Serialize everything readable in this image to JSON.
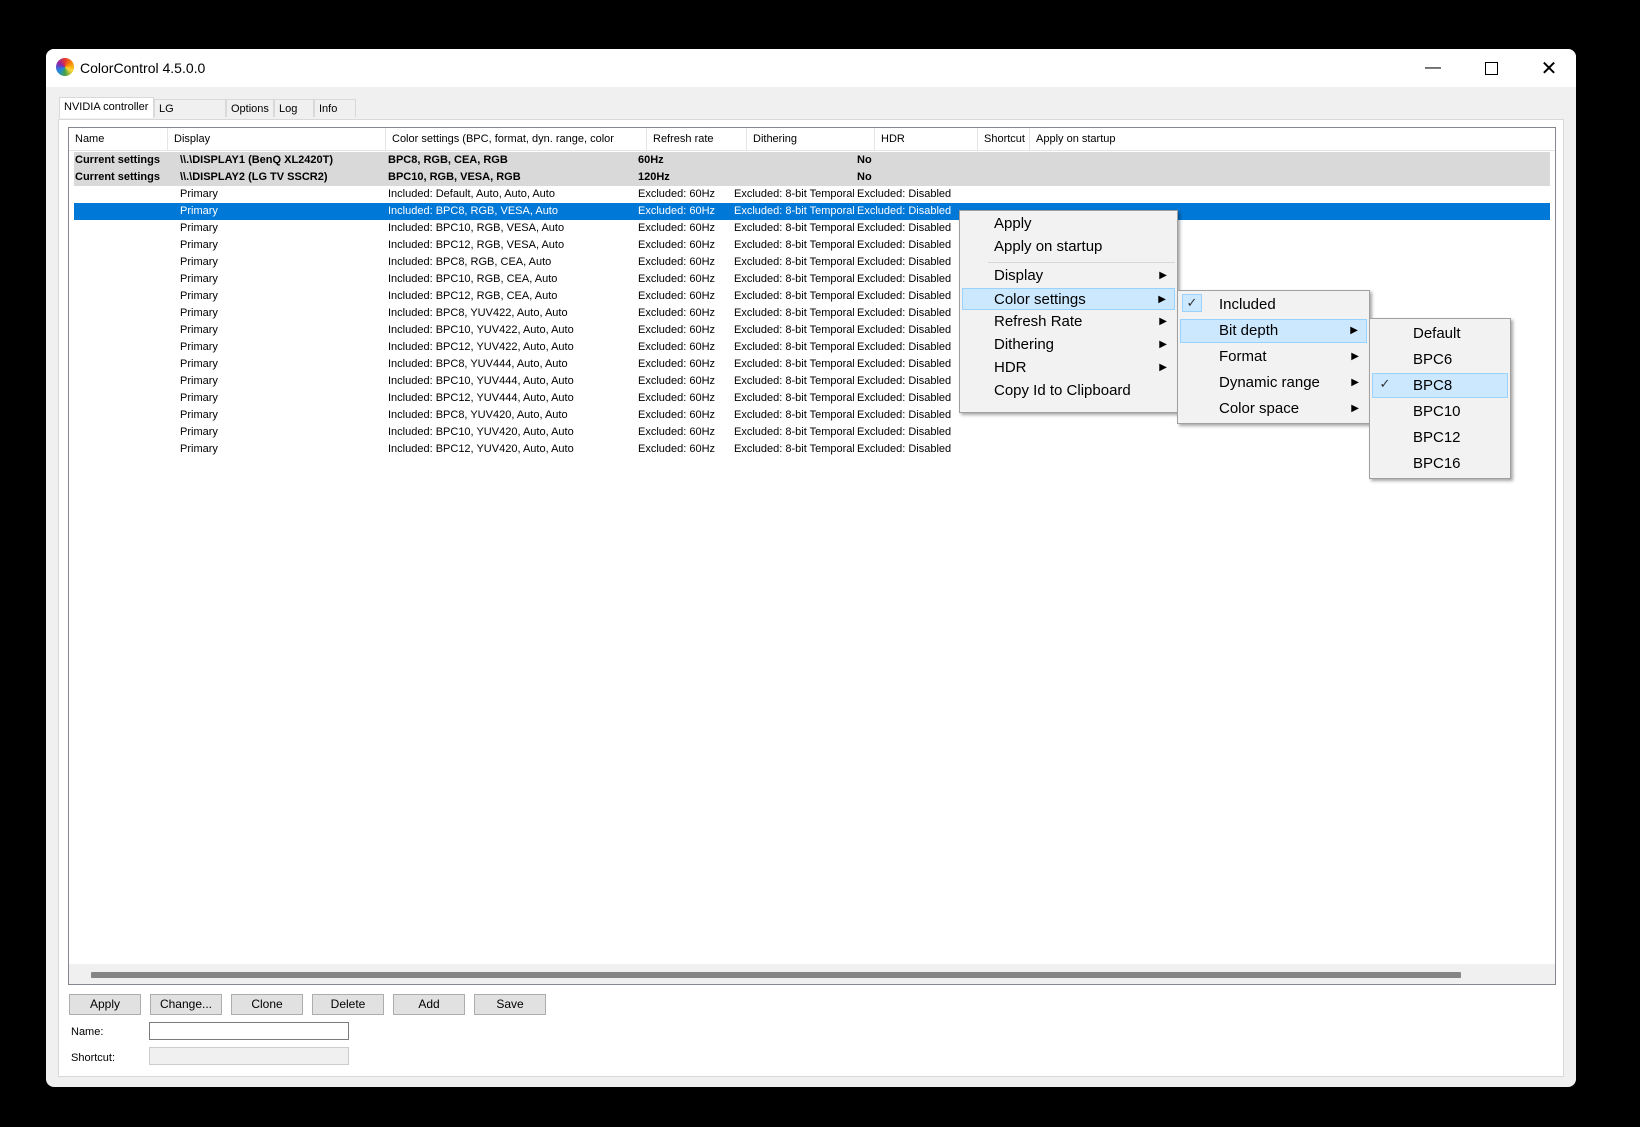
{
  "window": {
    "title": "ColorControl 4.5.0.0",
    "minimize_icon": "minimize-icon",
    "maximize_icon": "maximize-icon",
    "close_icon": "close-icon"
  },
  "tabs": [
    "NVIDIA controller",
    "LG controller",
    "Options",
    "Log",
    "Info"
  ],
  "columns": [
    "Name",
    "Display",
    "Color settings (BPC, format, dyn. range, color space)",
    "Refresh rate",
    "Dithering",
    "HDR",
    "Shortcut",
    "Apply on startup"
  ],
  "current_rows": [
    {
      "name": "Current settings",
      "display": "\\\\.\\DISPLAY1 (BenQ XL2420T)",
      "color": "BPC8, RGB, CEA, RGB",
      "refresh": "60Hz",
      "hdr": "No"
    },
    {
      "name": "Current settings",
      "display": "\\\\.\\DISPLAY2 (LG TV SSCR2)",
      "color": "BPC10, RGB, VESA, RGB",
      "refresh": "120Hz",
      "hdr": "No"
    }
  ],
  "rows": [
    {
      "display": "Primary",
      "color": "Included: Default, Auto, Auto, Auto",
      "refresh": "Excluded: 60Hz",
      "dithering": "Excluded: 8-bit Temporal",
      "hdr": "Excluded: Disabled"
    },
    {
      "display": "Primary",
      "color": "Included: BPC8, RGB, VESA, Auto",
      "refresh": "Excluded: 60Hz",
      "dithering": "Excluded: 8-bit Temporal",
      "hdr": "Excluded: Disabled"
    },
    {
      "display": "Primary",
      "color": "Included: BPC10, RGB, VESA, Auto",
      "refresh": "Excluded: 60Hz",
      "dithering": "Excluded: 8-bit Temporal",
      "hdr": "Excluded: Disabled"
    },
    {
      "display": "Primary",
      "color": "Included: BPC12, RGB, VESA, Auto",
      "refresh": "Excluded: 60Hz",
      "dithering": "Excluded: 8-bit Temporal",
      "hdr": "Excluded: Disabled"
    },
    {
      "display": "Primary",
      "color": "Included: BPC8, RGB, CEA, Auto",
      "refresh": "Excluded: 60Hz",
      "dithering": "Excluded: 8-bit Temporal",
      "hdr": "Excluded: Disabled"
    },
    {
      "display": "Primary",
      "color": "Included: BPC10, RGB, CEA, Auto",
      "refresh": "Excluded: 60Hz",
      "dithering": "Excluded: 8-bit Temporal",
      "hdr": "Excluded: Disabled"
    },
    {
      "display": "Primary",
      "color": "Included: BPC12, RGB, CEA, Auto",
      "refresh": "Excluded: 60Hz",
      "dithering": "Excluded: 8-bit Temporal",
      "hdr": "Excluded: Disabled"
    },
    {
      "display": "Primary",
      "color": "Included: BPC8, YUV422, Auto, Auto",
      "refresh": "Excluded: 60Hz",
      "dithering": "Excluded: 8-bit Temporal",
      "hdr": "Excluded: Disabled"
    },
    {
      "display": "Primary",
      "color": "Included: BPC10, YUV422, Auto, Auto",
      "refresh": "Excluded: 60Hz",
      "dithering": "Excluded: 8-bit Temporal",
      "hdr": "Excluded: Disabled"
    },
    {
      "display": "Primary",
      "color": "Included: BPC12, YUV422, Auto, Auto",
      "refresh": "Excluded: 60Hz",
      "dithering": "Excluded: 8-bit Temporal",
      "hdr": "Excluded: Disabled"
    },
    {
      "display": "Primary",
      "color": "Included: BPC8, YUV444, Auto, Auto",
      "refresh": "Excluded: 60Hz",
      "dithering": "Excluded: 8-bit Temporal",
      "hdr": "Excluded: Disabled"
    },
    {
      "display": "Primary",
      "color": "Included: BPC10, YUV444, Auto, Auto",
      "refresh": "Excluded: 60Hz",
      "dithering": "Excluded: 8-bit Temporal",
      "hdr": "Excluded: Disabled"
    },
    {
      "display": "Primary",
      "color": "Included: BPC12, YUV444, Auto, Auto",
      "refresh": "Excluded: 60Hz",
      "dithering": "Excluded: 8-bit Temporal",
      "hdr": "Excluded: Disabled"
    },
    {
      "display": "Primary",
      "color": "Included: BPC8, YUV420, Auto, Auto",
      "refresh": "Excluded: 60Hz",
      "dithering": "Excluded: 8-bit Temporal",
      "hdr": "Excluded: Disabled"
    },
    {
      "display": "Primary",
      "color": "Included: BPC10, YUV420, Auto, Auto",
      "refresh": "Excluded: 60Hz",
      "dithering": "Excluded: 8-bit Temporal",
      "hdr": "Excluded: Disabled"
    },
    {
      "display": "Primary",
      "color": "Included: BPC12, YUV420, Auto, Auto",
      "refresh": "Excluded: 60Hz",
      "dithering": "Excluded: 8-bit Temporal",
      "hdr": "Excluded: Disabled"
    }
  ],
  "selected_row": 1,
  "buttons": [
    "Apply",
    "Change...",
    "Clone",
    "Delete",
    "Add",
    "Save"
  ],
  "form": {
    "name_label": "Name:",
    "shortcut_label": "Shortcut:",
    "name_value": "",
    "shortcut_value": ""
  },
  "context_menu": {
    "items": [
      "Apply",
      "Apply on startup",
      "Display",
      "Color settings",
      "Refresh Rate",
      "Dithering",
      "HDR",
      "Copy Id to Clipboard"
    ],
    "highlighted": "Color settings"
  },
  "color_settings_menu": {
    "items": [
      "Included",
      "Bit depth",
      "Format",
      "Dynamic range",
      "Color space"
    ],
    "checked": "Included",
    "highlighted": "Bit depth"
  },
  "bit_depth_menu": {
    "items": [
      "Default",
      "BPC6",
      "BPC8",
      "BPC10",
      "BPC12",
      "BPC16"
    ],
    "checked": "BPC8"
  },
  "colors": {
    "selection": "#0078d7",
    "menu_highlight": "#cce8ff"
  }
}
